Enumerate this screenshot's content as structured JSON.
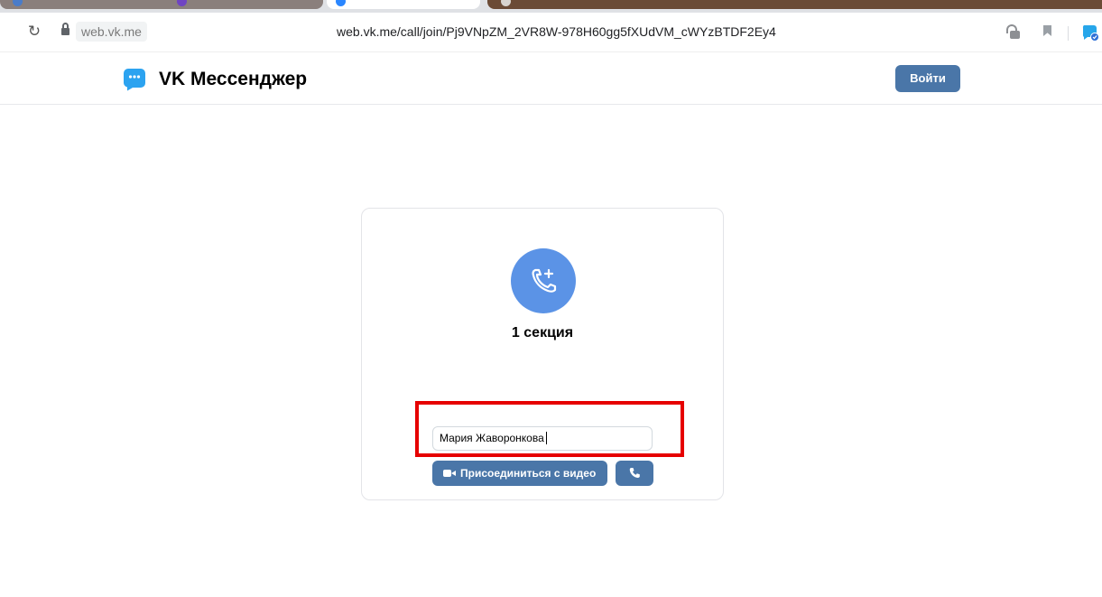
{
  "browser": {
    "domain_chip": "web.vk.me",
    "url": "web.vk.me/call/join/Pj9VNpZM_2VR8W-978H60gg5fXUdVM_cWYzBTDF2Ey4",
    "icons": [
      "reload-icon",
      "lock-icon",
      "extension-key-icon",
      "bookmark-icon",
      "vk-extension-icon"
    ]
  },
  "header": {
    "brand": "VK Мессенджер",
    "login_label": "Войти"
  },
  "join_card": {
    "title": "1 секция",
    "name_value": "Мария Жаворонкова",
    "join_video_label": "Присоединиться с видео"
  },
  "colors": {
    "accent": "#4a76a8",
    "avatar": "#5b93e6",
    "highlight": "#e60000"
  }
}
